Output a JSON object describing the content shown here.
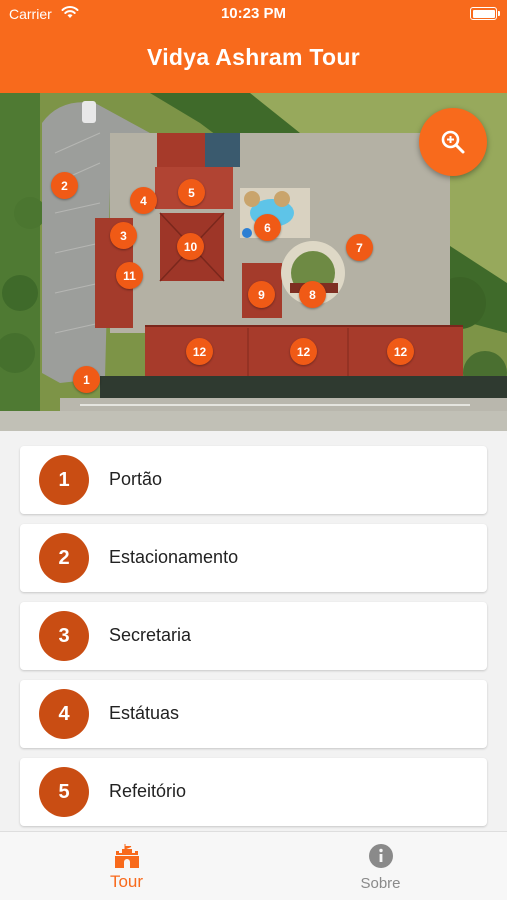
{
  "status_bar": {
    "carrier": "Carrier",
    "time": "10:23 PM"
  },
  "nav": {
    "title": "Vidya Ashram Tour"
  },
  "map": {
    "markers": [
      "1",
      "2",
      "3",
      "4",
      "5",
      "6",
      "7",
      "8",
      "9",
      "10",
      "11",
      "12",
      "12",
      "12"
    ],
    "zoom_button_icon": "zoom-in-icon"
  },
  "stops": [
    {
      "number": "1",
      "name": "Portão"
    },
    {
      "number": "2",
      "name": "Estacionamento"
    },
    {
      "number": "3",
      "name": "Secretaria"
    },
    {
      "number": "4",
      "name": "Estátuas"
    },
    {
      "number": "5",
      "name": "Refeitório"
    }
  ],
  "tabs": [
    {
      "label": "Tour",
      "icon": "castle-icon",
      "active": true
    },
    {
      "label": "Sobre",
      "icon": "info-icon",
      "active": false
    }
  ],
  "colors": {
    "accent": "#f86a1c",
    "marker": "#f05a16",
    "number_badge": "#c94d13",
    "inactive_tab": "#8a8a8a"
  }
}
